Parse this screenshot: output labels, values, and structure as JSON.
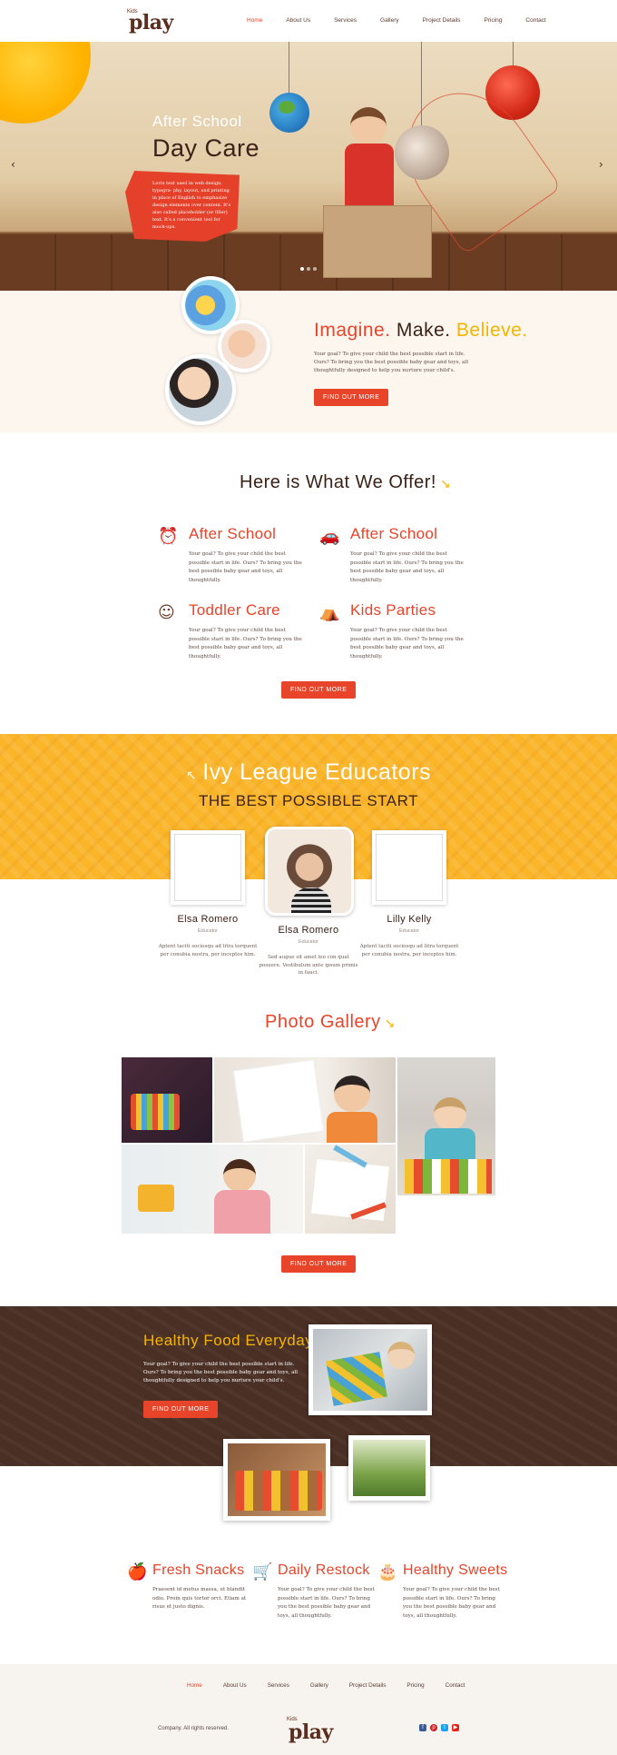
{
  "header": {
    "logo_small": "Kids",
    "logo_main": "play",
    "nav": [
      "Home",
      "About Us",
      "Services",
      "Gallery",
      "Project Details",
      "Pricing",
      "Contact"
    ],
    "active_index": 0
  },
  "hero": {
    "title_line1": "After School",
    "title_line2": "Day Care",
    "text": "Lorin text used in web design, typegra- phy, layout, and printing in place of English to emphasize design elements over content. It's also called placeholder (or filler) text. It's a convenient tool for mock-ups.",
    "prev_icon": "chevron-left-icon",
    "next_icon": "chevron-right-icon",
    "slides": 3,
    "active_slide": 0
  },
  "imagine": {
    "word1": "Imagine.",
    "word2": "Make.",
    "word3": "Believe.",
    "text": "Your goal? To give your child the best possible start in life. Ours? To bring you the best possible baby gear and toys, all thoughtfully designed to help you nurture your child's.",
    "button": "find out more"
  },
  "offer": {
    "title": "Here is What We Offer!",
    "items": [
      {
        "icon": "alarm-clock-icon",
        "title": "After School",
        "text": "Your goal? To give your child the best possible start in life. Ours? To bring you the best possible baby gear and toys, all thoughtfully."
      },
      {
        "icon": "toy-car-icon",
        "title": "After School",
        "text": "Your goal? To give your child the best possible start in life. Ours? To bring you the best possible baby gear and toys, all thoughtfully."
      },
      {
        "icon": "smiley-icon",
        "title": "Toddler Care",
        "text": "Your goal? To give your child the best possible start in life. Ours? To bring you the best possible baby gear and toys, all thoughtfully."
      },
      {
        "icon": "tent-icon",
        "title": "Kids Parties",
        "text": "Your goal? To give your child the best possible start in life. Ours? To bring you the best possible baby gear and toys, all thoughtfully."
      }
    ],
    "button": "find out more"
  },
  "educators": {
    "title": "Ivy League Educators",
    "subtitle": "the best possible start",
    "people": [
      {
        "name": "Elsa Romero",
        "role": "Educator",
        "text": "Aptent taciti sociosqu ad litra torquent per conubia nostra, per inceptos him."
      },
      {
        "name": "Elsa Romero",
        "role": "Educator",
        "text": "Sed augue sit amet leo con quat posuere. Vestibulum ante ipsum primis in fauci."
      },
      {
        "name": "Lilly Kelly",
        "role": "Educator",
        "text": "Aptent taciti sociosqu ad litra torquent per conubia nostra, per inceptos him."
      }
    ]
  },
  "gallery": {
    "title": "Photo Gallery",
    "button": "find out more"
  },
  "healthy": {
    "title": "Healthy Food Everyday",
    "text": "Your goal? To give your child the best possible start in life. Ours? To bring you the best possible baby gear and toys, all thoughtfully designed to help you nurture your child's.",
    "button": "find out more"
  },
  "food": [
    {
      "icon": "apple-icon",
      "title": "Fresh Snacks",
      "text": "Praesent id metus massa, ut blandit odio. Proin quis tortor orci. Etiam at risus et justo dignis."
    },
    {
      "icon": "cart-icon",
      "title": "Daily Restock",
      "text": "Your goal? To give your child the best possible start in life. Ours? To bring you the best possible baby gear and toys, all thoughtfully."
    },
    {
      "icon": "cake-icon",
      "title": "Healthy Sweets",
      "text": "Your goal? To give your child the best possible start in life. Ours? To bring you the best possible baby gear and toys, all thoughtfully."
    }
  ],
  "footer": {
    "nav": [
      "Home",
      "About Us",
      "Services",
      "Gallery",
      "Project Details",
      "Pricing",
      "Contact"
    ],
    "active_index": 0,
    "copyright": "Company. All rights reserved.",
    "logo_small": "Kids",
    "logo_main": "play",
    "social": [
      "facebook-icon",
      "pinterest-icon",
      "twitter-icon",
      "youtube-icon"
    ],
    "social_colors": [
      "#3b5998",
      "#cb2027",
      "#1da1f2",
      "#e62117"
    ]
  },
  "colors": {
    "accent_red": "#e8442a",
    "accent_yellow": "#fbb529",
    "brown": "#4a2f24",
    "dark_text": "#3b2116"
  }
}
